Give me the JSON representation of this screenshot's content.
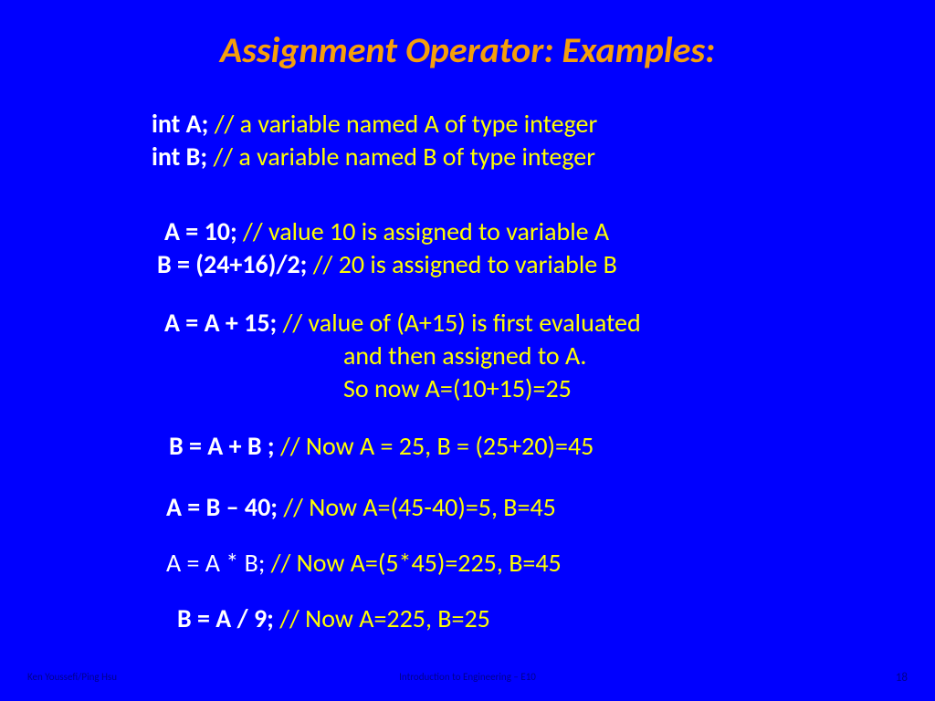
{
  "title": "Assignment Operator: Examples:",
  "l1": {
    "code": "int A; ",
    "comment": "// a variable named A of type integer"
  },
  "l2": {
    "code": "int B; ",
    "comment": "// a variable named B of type integer"
  },
  "l3": {
    "code": "A = 10; ",
    "comment": "// value 10 is assigned to variable A"
  },
  "l4": {
    "code": "B = (24+16)/2; ",
    "comment": "// 20 is assigned to variable B"
  },
  "l5": {
    "code": "A = A + 15; ",
    "comment": "// value of (A+15) is first evaluated"
  },
  "l5b": "and then assigned to A.",
  "l5c": "So now A=(10+15)=25",
  "l6": {
    "code": "B = A + B ;  ",
    "comment": "// Now A = 25, B = (25+20)=45"
  },
  "l7": {
    "code": "A = B – 40; ",
    "comment": "// Now A=(45-40)=5, B=45"
  },
  "l8": {
    "code": "A = A * B; ",
    "comment": "// Now A=(5*45)=225, B=45"
  },
  "l9": {
    "code": "B = A / 9; ",
    "comment": "// Now A=225, B=25"
  },
  "footer": {
    "left": "Ken Youssefi/Ping Hsu",
    "center": "Introduction to Engineering – E10",
    "right": "18"
  }
}
